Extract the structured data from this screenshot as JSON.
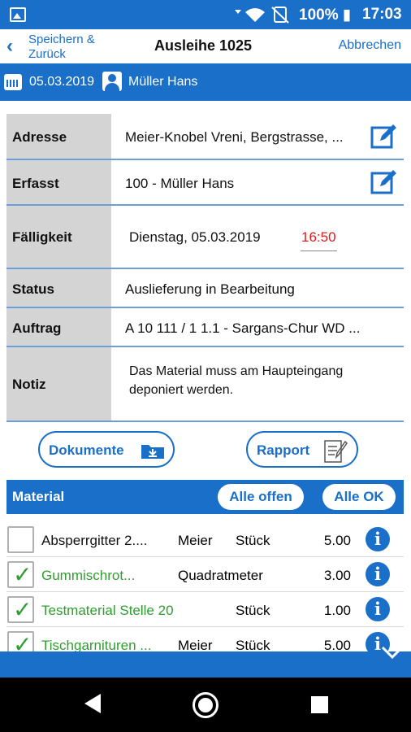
{
  "status_bar": {
    "battery": "100%",
    "time": "17:03",
    "status_icons": [
      "wifi-icon",
      "no-sim-icon",
      "battery-charging-icon"
    ]
  },
  "nav": {
    "back_label": "Speichern & Zurück",
    "title": "Ausleihe 1025",
    "cancel_label": "Abbrechen"
  },
  "info": {
    "date": "05.03.2019",
    "user": "Müller Hans"
  },
  "details": {
    "address": {
      "label": "Adresse",
      "value": "Meier-Knobel Vreni, Bergstrasse, ..."
    },
    "recorded": {
      "label": "Erfasst",
      "value": "100 - Müller Hans"
    },
    "due": {
      "label": "Fälligkeit",
      "date": "Dienstag, 05.03.2019",
      "time": "16:50"
    },
    "status": {
      "label": "Status",
      "value": "Auslieferung in Bearbeitung"
    },
    "order": {
      "label": "Auftrag",
      "value": "A 10 111 / 1 1.1  - Sargans-Chur WD ..."
    },
    "note": {
      "label": "Notiz",
      "value": "Das Material muss am Haupteingang deponiert werden."
    }
  },
  "buttons": {
    "documents": "Dokumente",
    "report": "Rapport"
  },
  "material": {
    "title": "Material",
    "all_open": "Alle offen",
    "all_ok": "Alle OK",
    "items": [
      {
        "name": "Absperrgitter 2....",
        "supplier": "Meier",
        "unit": "Stück",
        "qty": "5.00",
        "checked": false
      },
      {
        "name": "Gummischrot...",
        "supplier": "",
        "unit": "Quadratmeter",
        "qty": "3.00",
        "checked": true
      },
      {
        "name": "Testmaterial Stelle 20",
        "supplier": "",
        "unit": "Stück",
        "qty": "1.00",
        "checked": true
      },
      {
        "name": "Tischgarnituren ...",
        "supplier": "Meier",
        "unit": "Stück",
        "qty": "5.00",
        "checked": true
      }
    ]
  },
  "colors": {
    "accent": "#1a6fc9",
    "label_bg": "#d4d4d4",
    "due_red": "#e01919",
    "checked_green": "#2f9e2f"
  }
}
